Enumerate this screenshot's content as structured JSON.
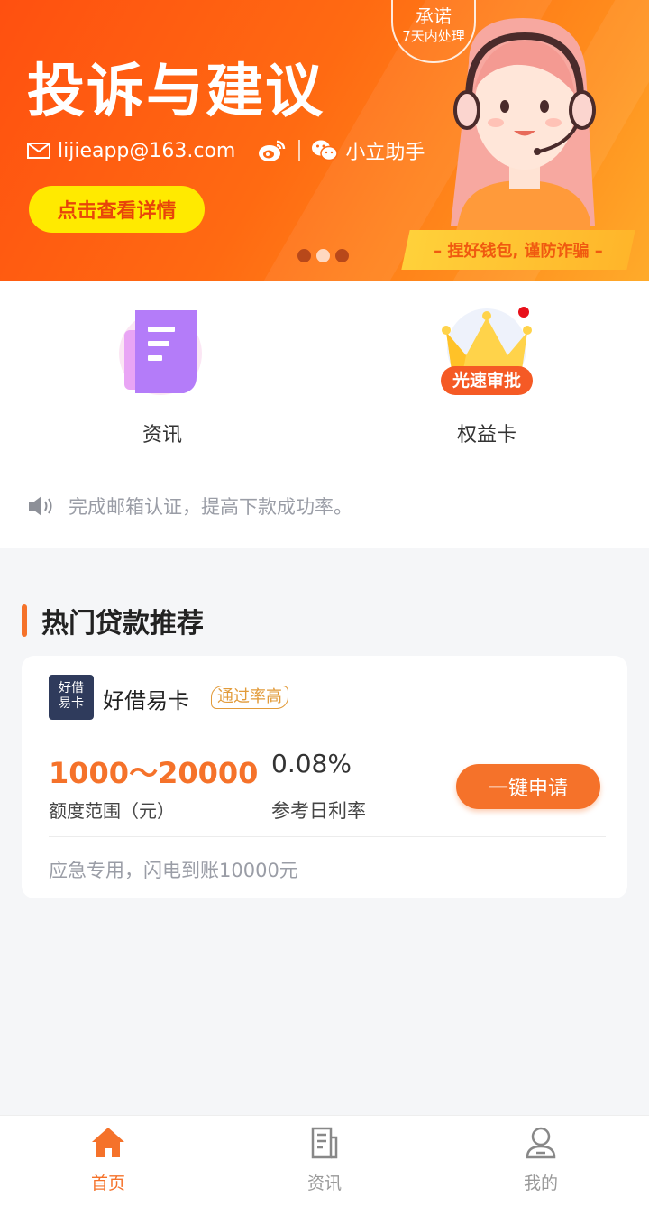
{
  "banner": {
    "title": "投诉与建议",
    "email": "lijieapp@163.com",
    "wechat_name": "小立助手",
    "cta_label": "点击查看详情",
    "promise_line1": "承诺",
    "promise_line2": "7天内处理",
    "anti_fraud": "– 捏好钱包, 谨防诈骗 –",
    "carousel_total": 3,
    "carousel_active_index": 1
  },
  "entries": [
    {
      "label": "资讯",
      "icon": "document-icon"
    },
    {
      "label": "权益卡",
      "icon": "crown-icon",
      "badge": "光速审批"
    }
  ],
  "notice": {
    "text": "完成邮箱认证，提高下款成功率。"
  },
  "section": {
    "title": "热门贷款推荐"
  },
  "loan_card": {
    "logo_text_1": "好借",
    "logo_text_2": "易卡",
    "name": "好借易卡",
    "tag": "通过率高",
    "amount_range": "1000～20000",
    "amount_label": "额度范围（元）",
    "rate": "0.08%",
    "rate_label": "参考日利率",
    "apply_label": "一键申请",
    "description": "应急专用，闪电到账10000元"
  },
  "tabbar": {
    "items": [
      {
        "label": "首页",
        "icon": "home-icon",
        "active": true
      },
      {
        "label": "资讯",
        "icon": "news-icon",
        "active": false
      },
      {
        "label": "我的",
        "icon": "user-icon",
        "active": false
      }
    ]
  },
  "colors": {
    "accent": "#f5722a",
    "banner_cta": "#ffea00",
    "red_dot": "#e8101a"
  }
}
